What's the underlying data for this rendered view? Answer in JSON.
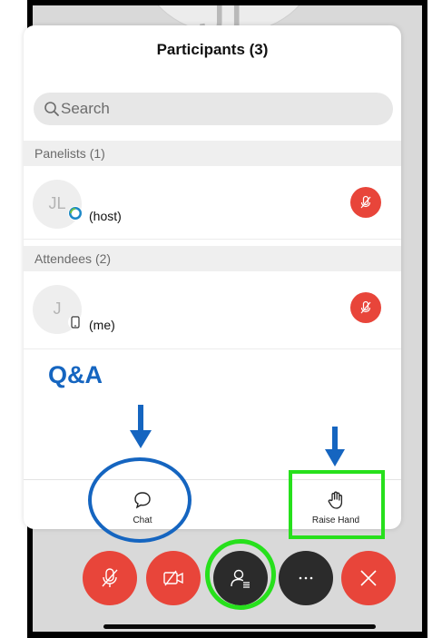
{
  "background": {
    "initials": "JL"
  },
  "panel": {
    "title": "Participants (3)",
    "search_placeholder": "Search",
    "sections": [
      {
        "header": "Panelists (1)",
        "participants": [
          {
            "initials": "JL",
            "role": "(host)",
            "badge": "webex-status-icon",
            "mic": "muted"
          }
        ]
      },
      {
        "header": "Attendees (2)",
        "participants": [
          {
            "initials": "J",
            "role": "(me)",
            "badge": "mobile-device-icon",
            "mic": "muted"
          }
        ]
      }
    ],
    "toolbar": {
      "chat_label": "Chat",
      "raise_hand_label": "Raise Hand"
    }
  },
  "annotation": {
    "qa_label": "Q&A",
    "accent_blue": "#1565c0",
    "accent_green": "#27e01c"
  },
  "call_controls": [
    "mute-mic",
    "stop-video",
    "participants",
    "more-options",
    "leave-meeting"
  ],
  "colors": {
    "danger": "#e8453a",
    "dark": "#2b2b2b",
    "backdrop": "#d9d9d9"
  }
}
